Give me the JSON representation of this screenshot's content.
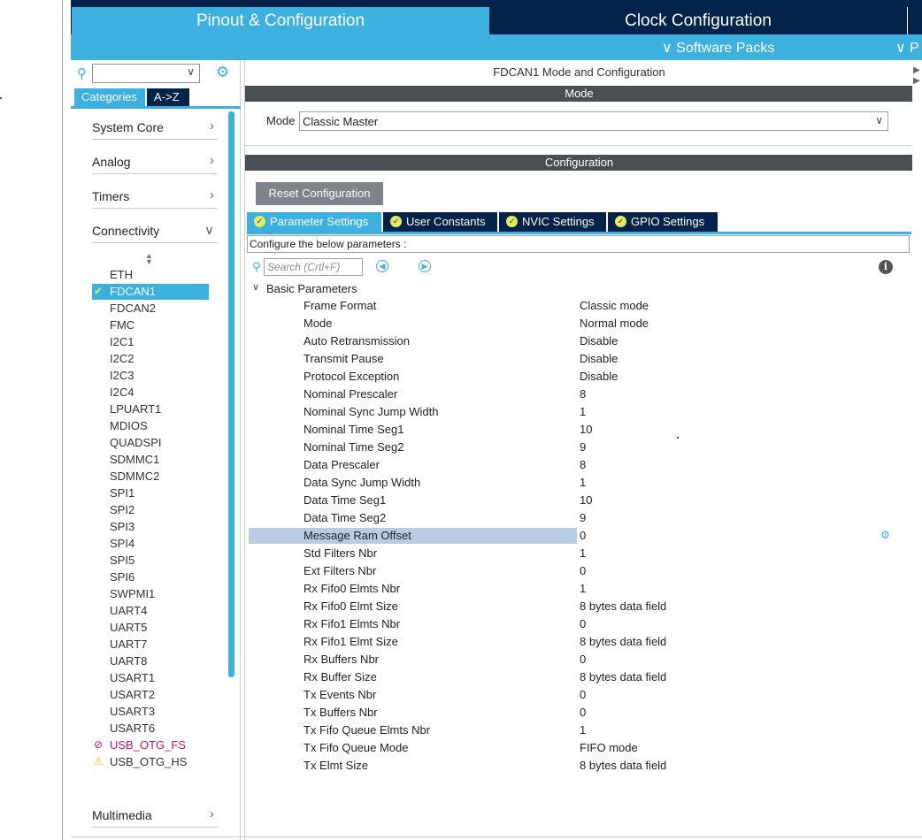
{
  "top_tabs": {
    "pinout": "Pinout & Configuration",
    "clock": "Clock Configuration"
  },
  "sub_bar": {
    "software_packs": "Software Packs",
    "truncated": "P"
  },
  "left_panel": {
    "tabs": {
      "categories": "Categories",
      "az": "A->Z"
    },
    "categories": [
      {
        "label": "System Core",
        "state": "collapsed"
      },
      {
        "label": "Analog",
        "state": "collapsed"
      },
      {
        "label": "Timers",
        "state": "collapsed"
      },
      {
        "label": "Connectivity",
        "state": "expanded"
      },
      {
        "label": "Multimedia",
        "state": "collapsed"
      }
    ],
    "peripherals": [
      {
        "label": "ETH",
        "status": "none"
      },
      {
        "label": "FDCAN1",
        "status": "selected"
      },
      {
        "label": "FDCAN2",
        "status": "none"
      },
      {
        "label": "FMC",
        "status": "none"
      },
      {
        "label": "I2C1",
        "status": "none"
      },
      {
        "label": "I2C2",
        "status": "none"
      },
      {
        "label": "I2C3",
        "status": "none"
      },
      {
        "label": "I2C4",
        "status": "none"
      },
      {
        "label": "LPUART1",
        "status": "none"
      },
      {
        "label": "MDIOS",
        "status": "none"
      },
      {
        "label": "QUADSPI",
        "status": "none"
      },
      {
        "label": "SDMMC1",
        "status": "none"
      },
      {
        "label": "SDMMC2",
        "status": "none"
      },
      {
        "label": "SPI1",
        "status": "none"
      },
      {
        "label": "SPI2",
        "status": "none"
      },
      {
        "label": "SPI3",
        "status": "none"
      },
      {
        "label": "SPI4",
        "status": "none"
      },
      {
        "label": "SPI5",
        "status": "none"
      },
      {
        "label": "SPI6",
        "status": "none"
      },
      {
        "label": "SWPMI1",
        "status": "none"
      },
      {
        "label": "UART4",
        "status": "none"
      },
      {
        "label": "UART5",
        "status": "none"
      },
      {
        "label": "UART7",
        "status": "none"
      },
      {
        "label": "UART8",
        "status": "none"
      },
      {
        "label": "USART1",
        "status": "none"
      },
      {
        "label": "USART2",
        "status": "none"
      },
      {
        "label": "USART3",
        "status": "none"
      },
      {
        "label": "USART6",
        "status": "none"
      },
      {
        "label": "USB_OTG_FS",
        "status": "disabled"
      },
      {
        "label": "USB_OTG_HS",
        "status": "warning"
      }
    ]
  },
  "main": {
    "title": "FDCAN1 Mode and Configuration",
    "mode_section": "Mode",
    "mode_label": "Mode",
    "mode_value": "Classic Master",
    "config_section": "Configuration",
    "reset_button": "Reset Configuration",
    "tabs": [
      {
        "label": "Parameter Settings",
        "active": true
      },
      {
        "label": "User Constants",
        "active": false
      },
      {
        "label": "NVIC Settings",
        "active": false
      },
      {
        "label": "GPIO Settings",
        "active": false
      }
    ],
    "hint": "Configure the below parameters :",
    "search_placeholder": "Search (Crtl+F)",
    "group": "Basic Parameters",
    "parameters": [
      {
        "name": "Frame Format",
        "value": "Classic mode"
      },
      {
        "name": "Mode",
        "value": "Normal mode"
      },
      {
        "name": "Auto Retransmission",
        "value": "Disable"
      },
      {
        "name": "Transmit Pause",
        "value": "Disable"
      },
      {
        "name": "Protocol Exception",
        "value": "Disable"
      },
      {
        "name": "Nominal Prescaler",
        "value": "8"
      },
      {
        "name": "Nominal Sync Jump Width",
        "value": "1"
      },
      {
        "name": "Nominal Time Seg1",
        "value": "10"
      },
      {
        "name": "Nominal Time Seg2",
        "value": "9"
      },
      {
        "name": "Data Prescaler",
        "value": "8"
      },
      {
        "name": "Data Sync Jump Width",
        "value": "1"
      },
      {
        "name": "Data Time Seg1",
        "value": "10"
      },
      {
        "name": "Data Time Seg2",
        "value": "9"
      },
      {
        "name": "Message Ram Offset",
        "value": "0",
        "highlighted": true
      },
      {
        "name": "Std Filters Nbr",
        "value": "1"
      },
      {
        "name": "Ext Filters Nbr",
        "value": "0"
      },
      {
        "name": "Rx Fifo0 Elmts Nbr",
        "value": "1"
      },
      {
        "name": "Rx Fifo0 Elmt Size",
        "value": "8 bytes data field"
      },
      {
        "name": "Rx Fifo1 Elmts Nbr",
        "value": "0"
      },
      {
        "name": "Rx Fifo1 Elmt Size",
        "value": "8 bytes data field"
      },
      {
        "name": "Rx Buffers Nbr",
        "value": "0"
      },
      {
        "name": "Rx Buffer Size",
        "value": "8 bytes data field"
      },
      {
        "name": "Tx Events Nbr",
        "value": "0"
      },
      {
        "name": "Tx Buffers Nbr",
        "value": "0"
      },
      {
        "name": "Tx Fifo Queue Elmts Nbr",
        "value": "1"
      },
      {
        "name": "Tx Fifo Queue Mode",
        "value": "FIFO mode"
      },
      {
        "name": "Tx Elmt Size",
        "value": "8 bytes data field"
      }
    ]
  },
  "icons": {
    "search": "search-icon",
    "gear": "gear-icon",
    "info": "info-icon",
    "check": "check-icon",
    "disabled": "no-entry-icon",
    "warning": "warning-icon"
  },
  "colors": {
    "accent": "#3cb1e0",
    "dark_navy": "#03234b",
    "section_bar": "#4a4f54",
    "highlight": "#b7cde6",
    "disabled_text": "#c2136e",
    "warning": "#f0c000"
  }
}
